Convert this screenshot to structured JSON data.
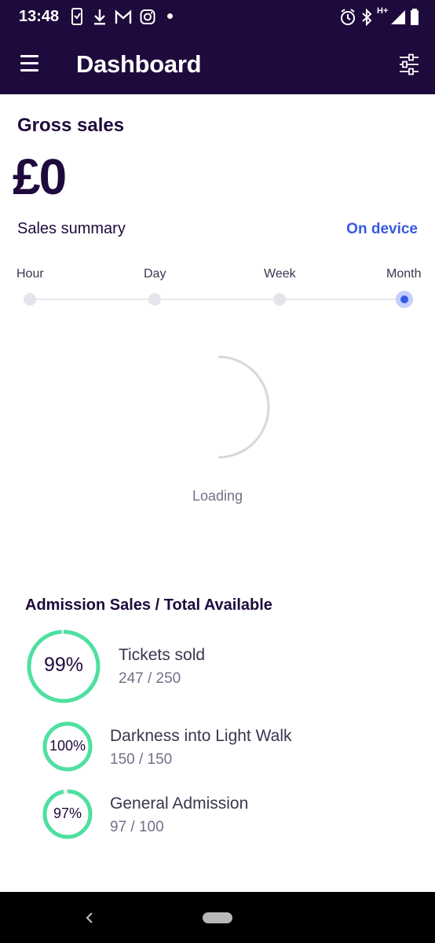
{
  "status_bar": {
    "time": "13:48",
    "network": "H+",
    "icons": [
      "screen-mirror-icon",
      "download-icon",
      "gmail-icon",
      "instagram-icon",
      "notification-dot",
      "alarm-icon",
      "bluetooth-icon",
      "signal-icon",
      "battery-icon"
    ]
  },
  "app_bar": {
    "title": "Dashboard",
    "left_icon": "menu-icon",
    "right_icon": "filter-sliders-icon"
  },
  "gross_sales": {
    "label": "Gross sales",
    "value": "£0"
  },
  "sales_summary": {
    "label": "Sales summary",
    "source_link": "On device",
    "timescale": {
      "options": [
        "Hour",
        "Day",
        "Week",
        "Month"
      ],
      "selected": "Month"
    },
    "loading_text": "Loading"
  },
  "admission": {
    "title": "Admission Sales / Total Available",
    "total": {
      "percent_label": "99%",
      "percent": 99,
      "name": "Tickets sold",
      "count": "247 / 250"
    },
    "items": [
      {
        "percent_label": "100%",
        "percent": 100,
        "name": "Darkness into Light Walk",
        "count": "150 / 150"
      },
      {
        "percent_label": "97%",
        "percent": 97,
        "name": "General Admission",
        "count": "97 / 100"
      }
    ]
  },
  "colors": {
    "brand_dark": "#1e0a3c",
    "link_blue": "#3659e3",
    "ring_green": "#4ee0a0"
  },
  "nav_bar": {
    "icons": [
      "back-icon",
      "home-pill-icon"
    ]
  }
}
